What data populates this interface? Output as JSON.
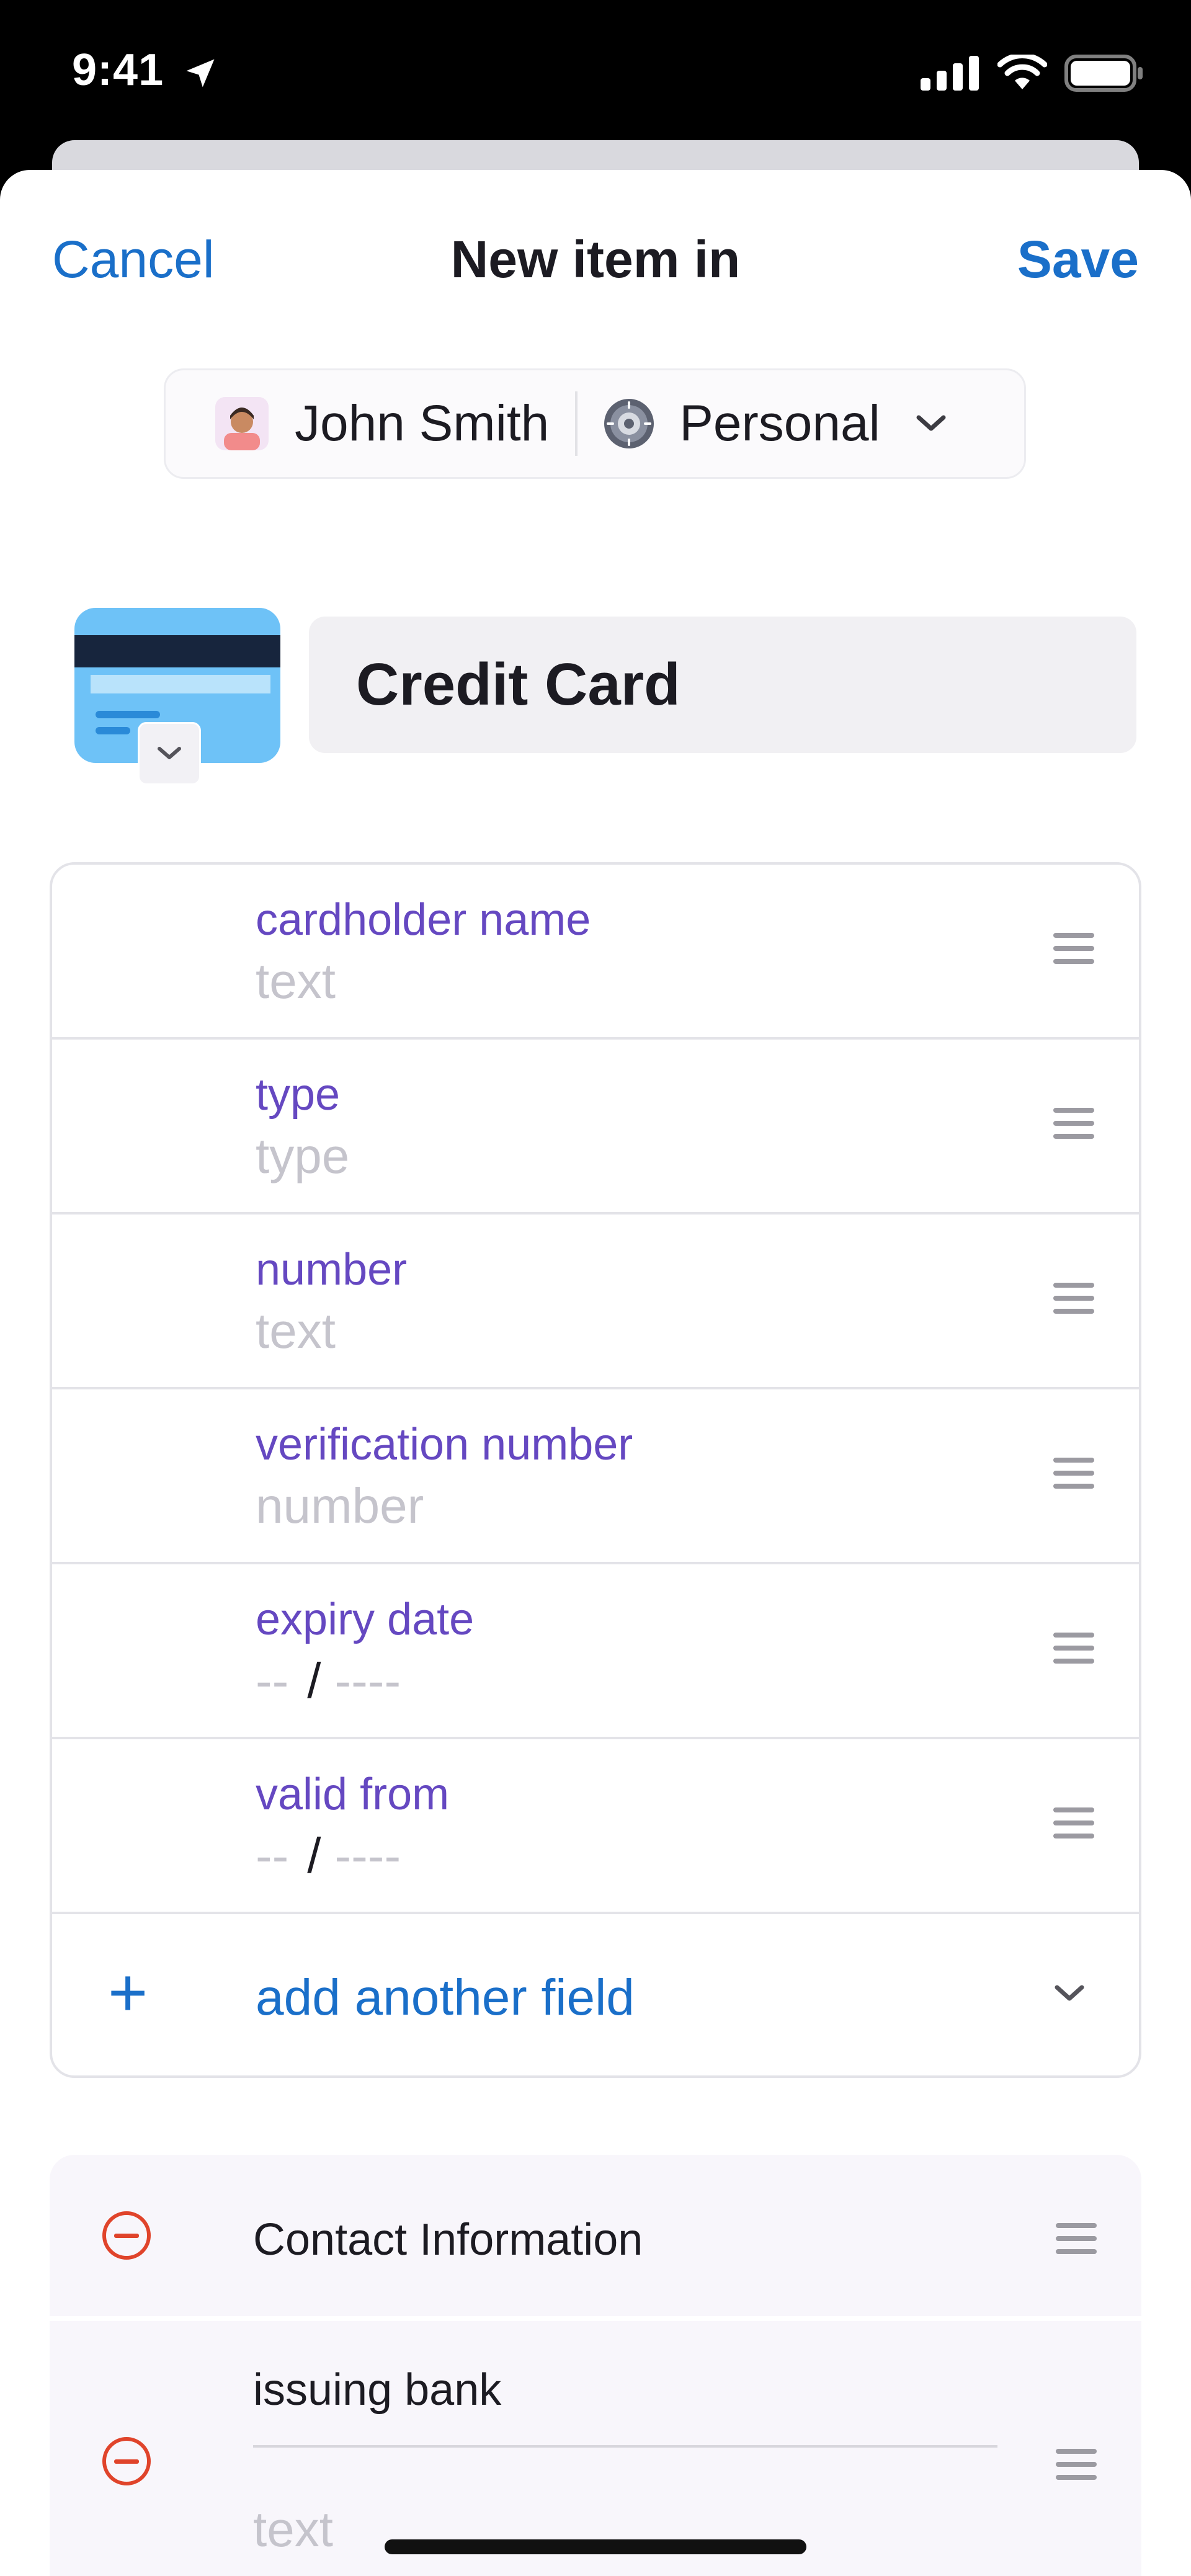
{
  "status_bar": {
    "time": "9:41",
    "icons": [
      "location-arrow-icon",
      "cellular-signal-icon",
      "wifi-icon",
      "battery-icon"
    ]
  },
  "nav": {
    "cancel_label": "Cancel",
    "title": "New item in",
    "save_label": "Save"
  },
  "vault_picker": {
    "account_name": "John Smith",
    "vault_name": "Personal"
  },
  "item": {
    "category_icon": "credit-card-icon",
    "title": "Credit Card"
  },
  "fields": [
    {
      "label": "cardholder name",
      "placeholder": "text"
    },
    {
      "label": "type",
      "placeholder": "type"
    },
    {
      "label": "number",
      "placeholder": "text"
    },
    {
      "label": "verification number",
      "placeholder": "number"
    },
    {
      "label": "expiry date",
      "month_placeholder": "--",
      "separator": "/",
      "year_placeholder": "----"
    },
    {
      "label": "valid from",
      "month_placeholder": "--",
      "separator": "/",
      "year_placeholder": "----"
    }
  ],
  "add_field": {
    "plus": "+",
    "label": "add another field"
  },
  "section": {
    "title": "Contact Information",
    "custom_field": {
      "label": "issuing bank",
      "placeholder": "text"
    }
  },
  "colors": {
    "accent_blue": "#1a6fc9",
    "field_label_purple": "#6548c1",
    "remove_red": "#e0442b",
    "placeholder_gray": "#c5c4cc"
  }
}
